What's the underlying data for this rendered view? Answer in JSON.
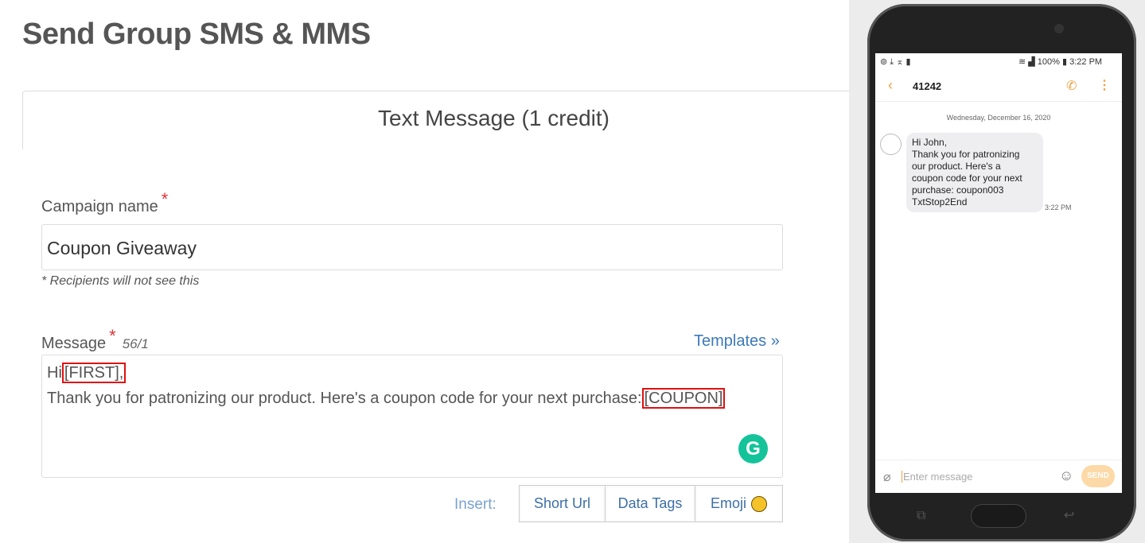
{
  "page": {
    "title": "Send Group SMS & MMS",
    "tab": "Text Message (1 credit)"
  },
  "form": {
    "campaign_label": "Campaign name",
    "required_mark": "*",
    "campaign_value": "Coupon Giveaway",
    "campaign_note": "* Recipients will not see this",
    "message_label": "Message",
    "message_count": "56/1",
    "templates_link": "Templates »",
    "message_line1_prefix": "Hi",
    "message_tag1": "[FIRST],",
    "message_line2_text": "Thank you for patronizing our product. Here's a coupon code for your next purchase:",
    "message_tag2": "[COUPON]",
    "grammarly": "G",
    "insert_label": "Insert:",
    "buttons": [
      "Short Url",
      "Data Tags",
      "Emoji"
    ]
  },
  "colors": {
    "accent_link": "#3d7ab8",
    "required": "#e0333a",
    "highlight": "#e01010",
    "grammarly": "#15c39a",
    "phone_accent": "#f0a040"
  },
  "phone": {
    "status_time": "3:22 PM",
    "battery": "100%",
    "contact": "41242",
    "date": "Wednesday, December 16, 2020",
    "bubble_lines": [
      "Hi John,",
      "Thank you for patronizing",
      "our product. Here's a",
      "coupon code for your next",
      "purchase: coupon003",
      "TxtStop2End"
    ],
    "bubble_time": "3:22 PM",
    "input_placeholder": "Enter message",
    "send": "SEND"
  }
}
